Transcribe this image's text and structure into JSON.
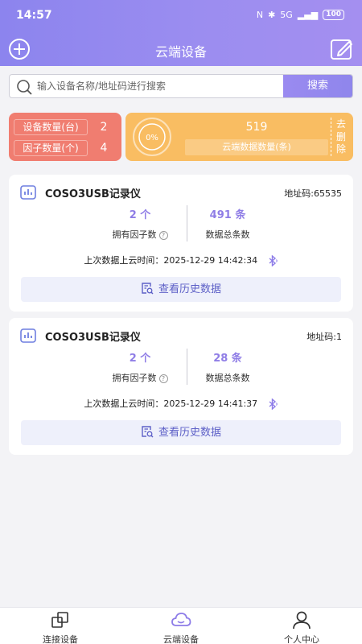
{
  "status_bar": {
    "time": "14:57",
    "battery": "100",
    "network": "5G"
  },
  "header": {
    "title": "云端设备"
  },
  "search": {
    "placeholder": "输入设备名称/地址码进行搜索",
    "button_label": "搜索"
  },
  "stats": {
    "device_count_label": "设备数量(台)",
    "device_count": "2",
    "factor_count_label": "因子数量(个)",
    "factor_count": "4",
    "progress_label": "0%",
    "progress_fraction": 0,
    "cloud_data_count": "519",
    "cloud_data_label": "云端数据数量(条)",
    "delete_label": "去删除"
  },
  "devices": [
    {
      "name": "COSO3USB记录仪",
      "address": "地址码:65535",
      "factor_value": "2 个",
      "factor_label": "拥有因子数",
      "data_value": "491 条",
      "data_label": "数据总条数",
      "upload_time": "上次数据上云时间：2025-12-29 14:42:34",
      "history_label": "查看历史数据"
    },
    {
      "name": "COSO3USB记录仪",
      "address": "地址码:1",
      "factor_value": "2 个",
      "factor_label": "拥有因子数",
      "data_value": "28 条",
      "data_label": "数据总条数",
      "upload_time": "上次数据上云时间：2025-12-29 14:41:37",
      "history_label": "查看历史数据"
    }
  ],
  "tabs": [
    {
      "label": "连接设备",
      "icon": "connect-device-icon"
    },
    {
      "label": "云端设备",
      "icon": "cloud-icon"
    },
    {
      "label": "个人中心",
      "icon": "person-icon"
    }
  ],
  "colors": {
    "accent": "#9b8df0",
    "stat_red": "#f07d70",
    "stat_orange": "#f9bd62",
    "value_purple": "#8f7de6"
  }
}
